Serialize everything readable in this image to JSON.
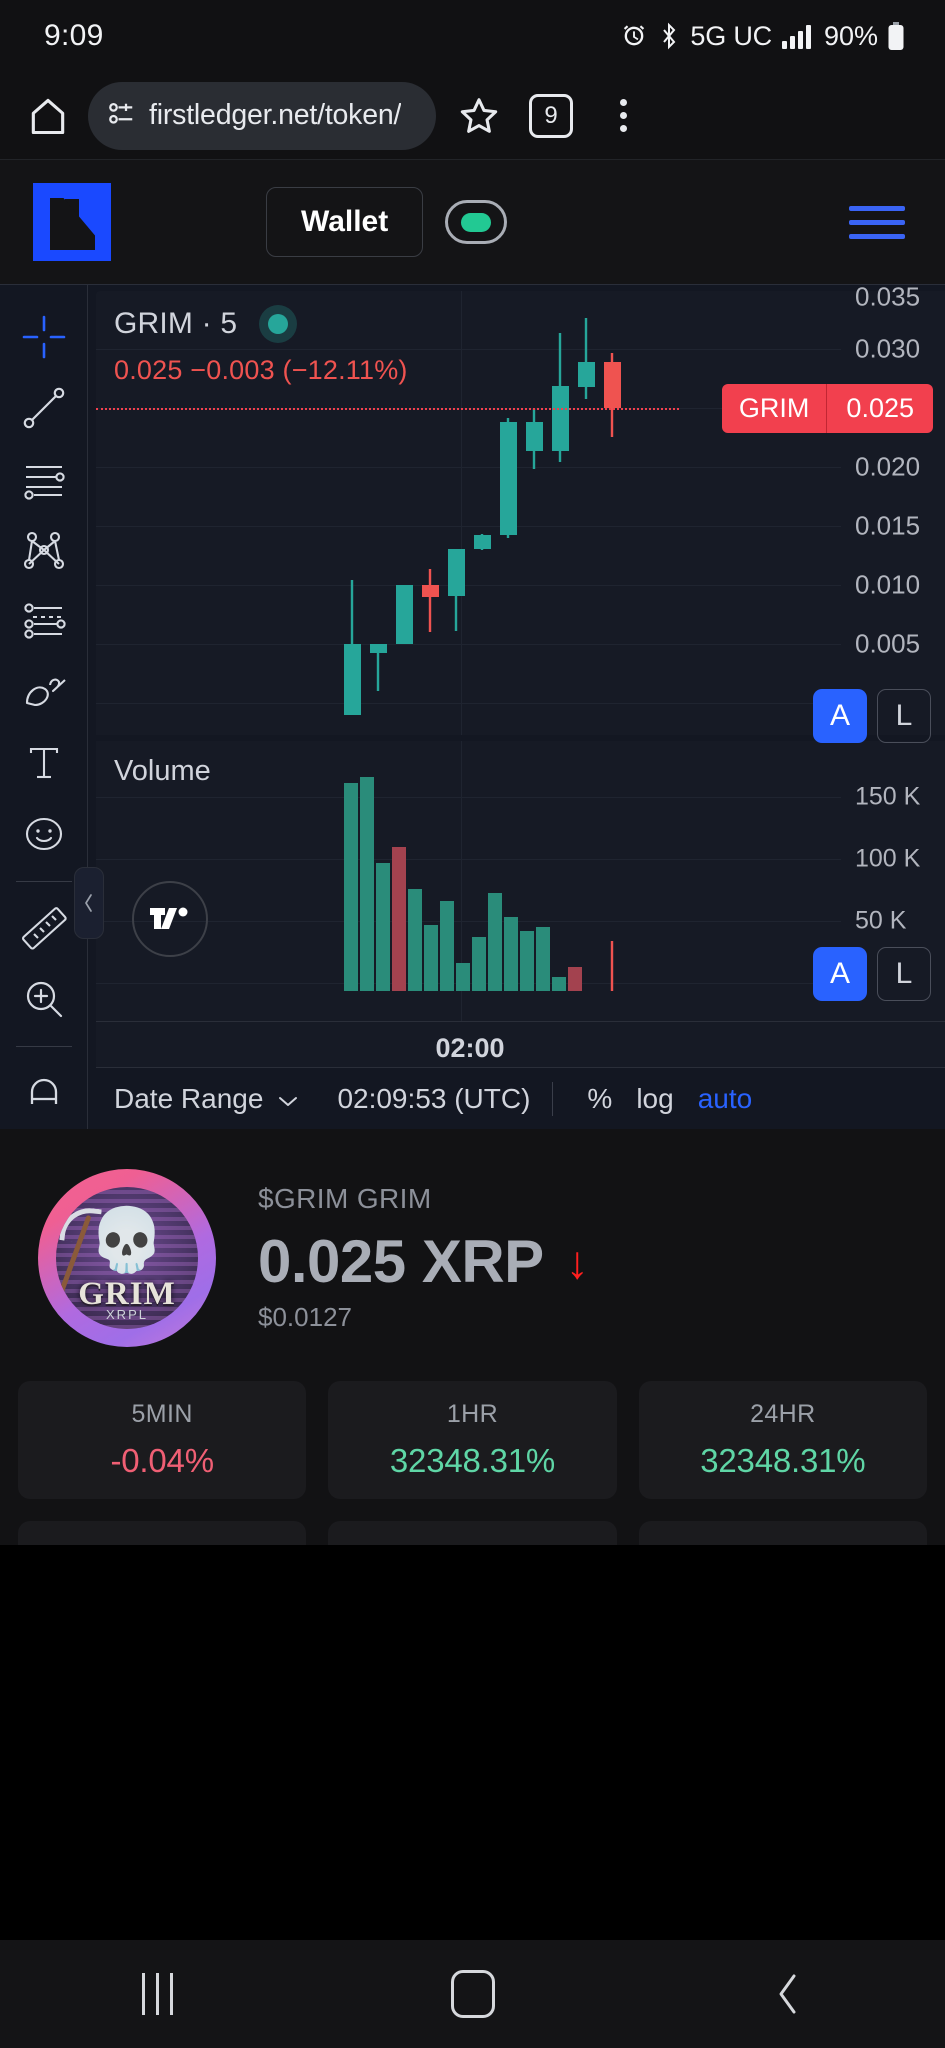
{
  "status_bar": {
    "time": "9:09",
    "network": "5G UC",
    "battery": "90%",
    "icons": [
      "alarm-icon",
      "bluetooth-icon",
      "signal-icon",
      "battery-icon"
    ]
  },
  "browser_bar": {
    "url": "firstledger.net/token/",
    "tab_count": "9",
    "icons": [
      "home-icon",
      "site-info-icon",
      "bookmark-star-icon",
      "tabs-icon",
      "overflow-menu-icon"
    ]
  },
  "site_header": {
    "logo": "firstledger-logo",
    "wallet_label": "Wallet",
    "network_toggle": "network-toggle",
    "menu": "hamburger-menu"
  },
  "chart": {
    "legend": {
      "symbol": "GRIM",
      "separator": "·",
      "interval": "5",
      "title": "GRIM · 5",
      "ohlc_line": "0.025  −0.003 (−12.11%)",
      "last_price": "0.025",
      "change_abs": "−0.003",
      "change_pct": "(−12.11%)"
    },
    "price_tag": {
      "symbol": "GRIM",
      "value": "0.025"
    },
    "volume_title": "Volume",
    "time_label": "02:00",
    "scale_buttons": {
      "auto": "A",
      "log": "L"
    },
    "footer": {
      "date_range": "Date Range",
      "chevron": "chevron-down-icon",
      "clock": "02:09:53 (UTC)",
      "percent": "%",
      "log": "log",
      "auto": "auto"
    },
    "tools": [
      "crosshair-tool-icon",
      "trend-line-tool-icon",
      "horizontal-lines-tool-icon",
      "pitchfork-tool-icon",
      "fib-retracement-tool-icon",
      "brush-tool-icon",
      "text-tool-icon",
      "emoji-tool-icon",
      "measure-ruler-icon",
      "zoom-in-icon",
      "magnet-icon"
    ],
    "brand": "tradingview-logo"
  },
  "chart_data": {
    "type": "line",
    "title": "GRIM · 5",
    "subtitle": "0.025  −0.003 (−12.11%)",
    "xlabel": "",
    "ylabel": "",
    "grid": true,
    "legend_position": "top-left",
    "panes": [
      {
        "name": "price",
        "type": "candlestick",
        "ylim": [
          0.0,
          0.0375
        ],
        "yticks": [
          0.005,
          0.01,
          0.015,
          0.02,
          0.025,
          0.03,
          0.035
        ],
        "ytick_labels": [
          "0.005",
          "0.010",
          "0.015",
          "0.020",
          "0.025",
          "0.030",
          "0.035"
        ],
        "price_line": 0.025,
        "up_color": "#26a69a",
        "down_color": "#ef5350",
        "candles": [
          {
            "o": 0.0005,
            "h": 0.0105,
            "l": 0.0003,
            "c": 0.0045,
            "dir": "up"
          },
          {
            "o": 0.0045,
            "h": 0.006,
            "l": 0.002,
            "c": 0.0052,
            "dir": "up"
          },
          {
            "o": 0.005,
            "h": 0.0098,
            "l": 0.0045,
            "c": 0.0096,
            "dir": "up"
          },
          {
            "o": 0.0095,
            "h": 0.0112,
            "l": 0.006,
            "c": 0.007,
            "dir": "down"
          },
          {
            "o": 0.007,
            "h": 0.0128,
            "l": 0.0062,
            "c": 0.012,
            "dir": "up"
          },
          {
            "o": 0.012,
            "h": 0.0142,
            "l": 0.0115,
            "c": 0.0138,
            "dir": "up"
          },
          {
            "o": 0.0136,
            "h": 0.024,
            "l": 0.013,
            "c": 0.0232,
            "dir": "up"
          },
          {
            "o": 0.023,
            "h": 0.0248,
            "l": 0.0196,
            "c": 0.0212,
            "dir": "up"
          },
          {
            "o": 0.0212,
            "h": 0.0312,
            "l": 0.0205,
            "c": 0.0268,
            "dir": "up"
          },
          {
            "o": 0.0266,
            "h": 0.033,
            "l": 0.025,
            "c": 0.0288,
            "dir": "up"
          },
          {
            "o": 0.0288,
            "h": 0.03,
            "l": 0.0225,
            "c": 0.025,
            "dir": "down"
          }
        ]
      },
      {
        "name": "volume",
        "type": "bar",
        "ylim": [
          0,
          180000
        ],
        "yticks": [
          50000,
          100000,
          150000
        ],
        "ytick_labels": [
          "50 K",
          "100 K",
          "150 K"
        ],
        "values": [
          160000,
          168000,
          72000,
          88000,
          52000,
          30000,
          44000,
          12000,
          26000,
          48000,
          36000,
          42000,
          38000,
          8000,
          16000
        ],
        "directions": [
          "up",
          "up",
          "up",
          "down",
          "up",
          "up",
          "up",
          "up",
          "up",
          "up",
          "up",
          "up",
          "up",
          "up",
          "down"
        ],
        "up_color": "#2a8c7a",
        "down_color": "#a3424f"
      }
    ]
  },
  "token": {
    "symbol_line": "$GRIM GRIM",
    "price": "0.025 XRP",
    "trend": "down-arrow-icon",
    "usd": "$0.0127",
    "logo_name": "GRIM",
    "logo_sub": "XRPL"
  },
  "stats": [
    {
      "label": "5MIN",
      "value": "-0.04%",
      "dir": "neg"
    },
    {
      "label": "1HR",
      "value": "32348.31%",
      "dir": "pos"
    },
    {
      "label": "24HR",
      "value": "32348.31%",
      "dir": "pos"
    }
  ],
  "nav_bar": {
    "recents": "recents-icon",
    "home": "home-icon",
    "back": "back-icon"
  }
}
